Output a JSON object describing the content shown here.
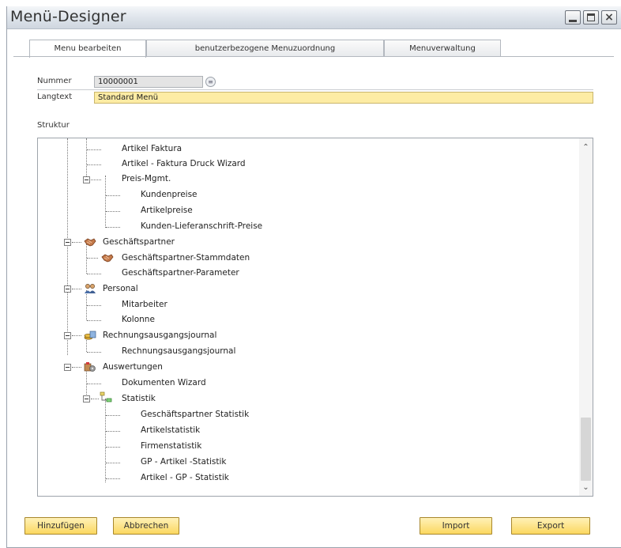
{
  "window": {
    "title": "Menü-Designer",
    "controls": [
      "minimize-icon",
      "maximize-icon",
      "close-icon"
    ],
    "close_glyph": "×"
  },
  "tabs": [
    {
      "label": "Menu bearbeiten",
      "active": true
    },
    {
      "label": "benutzerbezogene Menuzuordnung",
      "active": false
    },
    {
      "label": "Menuverwaltung",
      "active": false
    }
  ],
  "form": {
    "nummer_label": "Nummer",
    "nummer_value": "10000001",
    "link_glyph": "≡",
    "langtext_label": "Langtext",
    "langtext_value": "Standard Menü",
    "struktur_label": "Struktur"
  },
  "tree": {
    "items": [
      {
        "label": "Artikel Faktura",
        "level": 3
      },
      {
        "label": "Artikel - Faktura Druck Wizard",
        "level": 3
      },
      {
        "label": "Preis-Mgmt.",
        "level": 3,
        "expanded": true
      },
      {
        "label": "Kundenpreise",
        "level": 4
      },
      {
        "label": "Artikelpreise",
        "level": 4
      },
      {
        "label": "Kunden-Lieferanschrift-Preise",
        "level": 4
      },
      {
        "label": "Geschäftspartner",
        "level": 1,
        "expanded": true,
        "icon": "handshake-icon"
      },
      {
        "label": "Geschäftspartner-Stammdaten",
        "level": 2,
        "icon": "handshake-icon"
      },
      {
        "label": "Geschäftspartner-Parameter",
        "level": 2
      },
      {
        "label": "Personal",
        "level": 1,
        "expanded": true,
        "icon": "people-icon"
      },
      {
        "label": "Mitarbeiter",
        "level": 2
      },
      {
        "label": "Kolonne",
        "level": 2
      },
      {
        "label": "Rechnungsausgangsjournal",
        "level": 1,
        "expanded": true,
        "icon": "coins-icon"
      },
      {
        "label": "Rechnungsausgangsjournal",
        "level": 2
      },
      {
        "label": "Auswertungen",
        "level": 1,
        "expanded": true,
        "icon": "reports-icon"
      },
      {
        "label": "Dokumenten Wizard",
        "level": 2
      },
      {
        "label": "Statistik",
        "level": 2,
        "expanded": true,
        "icon": "folder-tree-icon"
      },
      {
        "label": "Geschäftspartner Statistik",
        "level": 3
      },
      {
        "label": "Artikelstatistik",
        "level": 3
      },
      {
        "label": "Firmenstatistik",
        "level": 3
      },
      {
        "label": "GP - Artikel -Statistik",
        "level": 3
      },
      {
        "label": "Artikel - GP - Statistik",
        "level": 3
      }
    ],
    "scroll_up_glyph": "⌃",
    "scroll_down_glyph": "⌄"
  },
  "buttons": {
    "add": "Hinzufügen",
    "cancel": "Abbrechen",
    "import": "Import",
    "export": "Export"
  },
  "colors": {
    "button_fill": "#fbd860",
    "highlight_field": "#fdeca4"
  }
}
